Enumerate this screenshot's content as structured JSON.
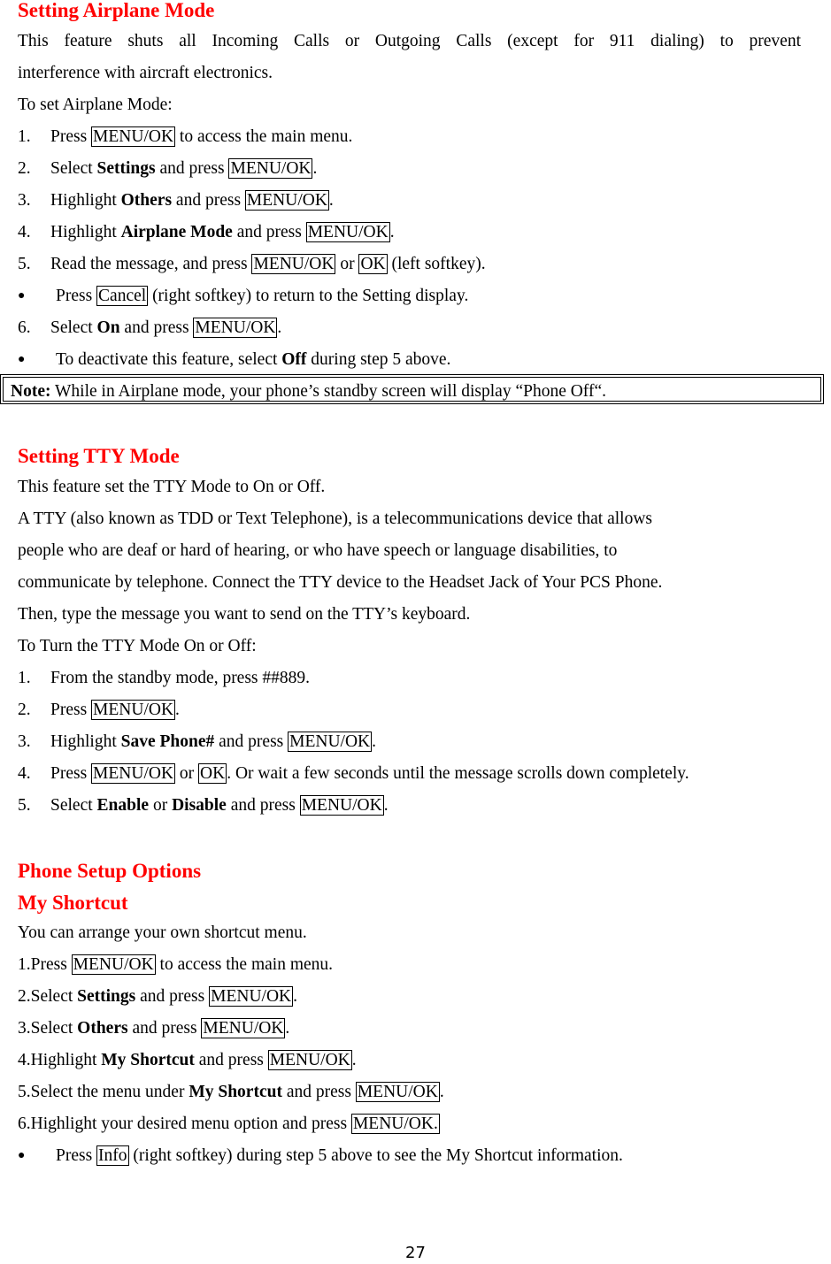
{
  "airplane": {
    "title": "Setting Airplane Mode",
    "intro_line1": "This feature shuts all Incoming Calls or Outgoing Calls (except for 911 dialing) to prevent",
    "intro_line2": "interference with aircraft electronics.",
    "lead": "To set Airplane Mode:",
    "steps": [
      {
        "num": "1.",
        "pre": "Press ",
        "key1": "MENU/OK",
        "post": " to access the main menu."
      },
      {
        "num": "2.",
        "pre": "Select ",
        "bold": "Settings",
        "mid": " and press ",
        "key1": "MENU/OK",
        "post": "."
      },
      {
        "num": "3.",
        "pre": "Highlight ",
        "bold": "Others",
        "mid": " and press ",
        "key1": "MENU/OK",
        "post": "."
      },
      {
        "num": "4.",
        "pre": "Highlight ",
        "bold": "Airplane Mode",
        "mid": " and press ",
        "key1": "MENU/OK",
        "post": "."
      },
      {
        "num": "5.",
        "pre": "Read the message, and press ",
        "key1": "MENU/OK",
        "mid": " or ",
        "key2": "OK",
        "post": " (left softkey)."
      },
      {
        "bullet": "●",
        "pre": "Press ",
        "key1": "Cancel",
        "post": " (right softkey) to return to the Setting display."
      },
      {
        "num": "6.",
        "pre": "Select ",
        "bold": "On",
        "mid": " and press ",
        "key1": "MENU/OK",
        "post": "."
      },
      {
        "bullet": "●",
        "pre": "To deactivate this feature, select ",
        "bold": "Off",
        "post": " during step 5 above."
      }
    ],
    "note_label": "Note:",
    "note_text": " While in Airplane mode, your phone’s standby screen will display “Phone Off“."
  },
  "tty": {
    "title": "Setting TTY Mode",
    "paragraph": [
      "This feature set the TTY Mode to On or Off.",
      "A TTY (also known as TDD or Text Telephone), is a telecommunications device that allows",
      "people who are deaf or hard of hearing, or who have speech or language disabilities, to",
      "communicate by telephone. Connect the TTY device to the Headset Jack of Your PCS Phone.",
      "Then, type the message you want to send on the TTY’s keyboard."
    ],
    "lead": "To Turn the TTY Mode On or Off:",
    "steps": [
      {
        "num": "1.",
        "pre": "From the standby mode, press ##889."
      },
      {
        "num": "2.",
        "pre": "Press ",
        "key1": "MENU/OK",
        "post": "."
      },
      {
        "num": "3.",
        "pre": "Highlight ",
        "bold": "Save Phone#",
        "mid": " and press ",
        "key1": "MENU/OK",
        "post": "."
      },
      {
        "num": "4.",
        "pre": "Press ",
        "key1": "MENU/OK",
        "mid": " or ",
        "key2": "OK",
        "post": ". Or wait a few seconds until the message scrolls down completely."
      },
      {
        "num": "5.",
        "pre": "Select ",
        "bold": "Enable",
        "mid": " or ",
        "bold2": "Disable",
        "mid2": " and press ",
        "key1": "MENU/OK",
        "post": "."
      }
    ]
  },
  "setup": {
    "title": "Phone Setup Options",
    "subtitle": "My Shortcut",
    "intro": "You can arrange your own shortcut menu.",
    "steps": [
      {
        "num": "1. ",
        "pre": "Press ",
        "key1": "MENU/OK",
        "post": " to access the main menu."
      },
      {
        "num": "2. ",
        "pre": "Select ",
        "bold": "Settings",
        "mid": " and press ",
        "key1": "MENU/OK",
        "post": "."
      },
      {
        "num": "3. ",
        "pre": "Select ",
        "bold": "Others",
        "mid": " and press ",
        "key1": "MENU/OK",
        "post": "."
      },
      {
        "num": "4. ",
        "pre": "Highlight ",
        "bold": "My Shortcut",
        "mid": " and press ",
        "key1": "MENU/OK",
        "post": "."
      },
      {
        "num": "5. ",
        "pre": "Select the menu under ",
        "bold": "My Shortcut",
        "mid": " and press ",
        "key1": "MENU/OK",
        "post": "."
      },
      {
        "num": "6. ",
        "pre": "Highlight your desired menu option and press ",
        "key1": "MENU/OK."
      },
      {
        "bullet": "●",
        "pre": "Press ",
        "key1": "Info",
        "post": " (right softkey) during step 5 above to see the My Shortcut information."
      }
    ]
  },
  "page_number": "27"
}
